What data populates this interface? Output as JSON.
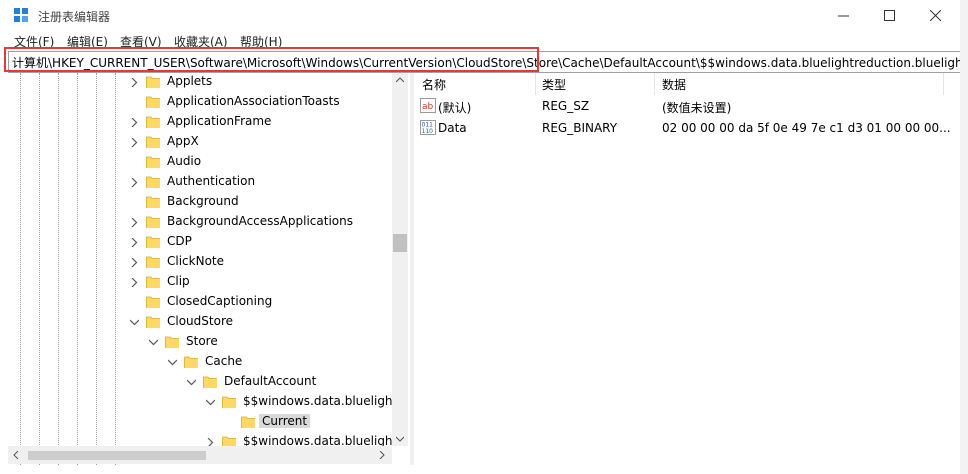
{
  "window": {
    "title": "注册表编辑器"
  },
  "menu": [
    "文件(F)",
    "编辑(E)",
    "查看(V)",
    "收藏夹(A)",
    "帮助(H)"
  ],
  "address": "计算机\\HKEY_CURRENT_USER\\Software\\Microsoft\\Windows\\CurrentVersion\\CloudStore\\Store\\Cache\\DefaultAccount\\$$windows.data.bluelightreduction.bluelightre",
  "tree": [
    {
      "label": "Applets",
      "expander": "collapsed"
    },
    {
      "label": "ApplicationAssociationToasts",
      "expander": "none"
    },
    {
      "label": "ApplicationFrame",
      "expander": "collapsed"
    },
    {
      "label": "AppX",
      "expander": "collapsed"
    },
    {
      "label": "Audio",
      "expander": "none"
    },
    {
      "label": "Authentication",
      "expander": "collapsed"
    },
    {
      "label": "Background",
      "expander": "none"
    },
    {
      "label": "BackgroundAccessApplications",
      "expander": "collapsed"
    },
    {
      "label": "CDP",
      "expander": "collapsed"
    },
    {
      "label": "ClickNote",
      "expander": "collapsed"
    },
    {
      "label": "Clip",
      "expander": "collapsed"
    },
    {
      "label": "ClosedCaptioning",
      "expander": "none"
    },
    {
      "label": "CloudStore",
      "expander": "expanded"
    },
    {
      "label": "Store",
      "expander": "expanded"
    },
    {
      "label": "Cache",
      "expander": "expanded"
    },
    {
      "label": "DefaultAccount",
      "expander": "expanded"
    },
    {
      "label": "$$windows.data.bluelightr",
      "expander": "expanded"
    },
    {
      "label": "Current",
      "expander": "none"
    },
    {
      "label": "$$windows.data.bluelightr",
      "expander": "collapsed"
    }
  ],
  "columns": [
    "名称",
    "类型",
    "数据"
  ],
  "values": [
    {
      "icon": "string-value-icon",
      "name": "(默认)",
      "type": "REG_SZ",
      "data": "(数值未设置)"
    },
    {
      "icon": "binary-value-icon",
      "name": "Data",
      "type": "REG_BINARY",
      "data": "02 00 00 00 da 5f 0e 49 7e c1 d3 01 00 00 00..."
    }
  ],
  "colors": {
    "highlight_border": "#e53935",
    "folder": "#ffd866",
    "selected": "#d9d9d9"
  }
}
